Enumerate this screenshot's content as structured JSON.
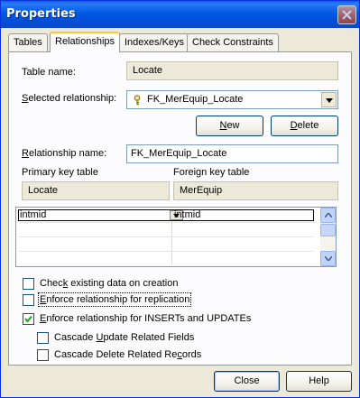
{
  "window": {
    "title": "Properties"
  },
  "tabs": [
    {
      "label": "Tables"
    },
    {
      "label": "Relationships"
    },
    {
      "label": "Indexes/Keys"
    },
    {
      "label": "Check Constraints"
    }
  ],
  "form": {
    "table_name_label": "Table name:",
    "table_name_value": "Locate",
    "selected_rel_label_pre": "",
    "selected_rel_label_u": "S",
    "selected_rel_label_post": "elected relationship:",
    "selected_rel_value": "FK_MerEquip_Locate",
    "new_button_u": "N",
    "new_button_post": "ew",
    "delete_button_u": "D",
    "delete_button_post": "elete",
    "rel_name_label_u": "R",
    "rel_name_label_post": "elationship name:",
    "rel_name_value": "FK_MerEquip_Locate",
    "primary_key_table_label": "Primary key table",
    "primary_key_table_value": "Locate",
    "foreign_key_table_label": "Foreign key table",
    "foreign_key_table_value": "MerEquip"
  },
  "columns_grid": {
    "rows": [
      {
        "primary": "intmid",
        "foreign": "intmid"
      }
    ]
  },
  "options": [
    {
      "pre": "Chec",
      "u": "k",
      "post": " existing data on creation",
      "checked": false
    },
    {
      "pre": "",
      "u": "E",
      "post": "nforce relationship for replication",
      "checked": false
    },
    {
      "pre": "",
      "u": "E",
      "post": "nforce relationship for INSERTs and UPDATEs",
      "checked": true
    },
    {
      "pre": "Cascade ",
      "u": "U",
      "post": "pdate Related Fields",
      "checked": false
    },
    {
      "pre": "Cascade Delete Related Re",
      "u": "c",
      "post": "ords",
      "checked": false
    }
  ],
  "footer": {
    "close_label": "Close",
    "help_label": "Help"
  },
  "colors": {
    "title_bar": "#0058e6",
    "dialog_bg": "#ece9d8",
    "tab_highlight": "#ffc83c"
  }
}
